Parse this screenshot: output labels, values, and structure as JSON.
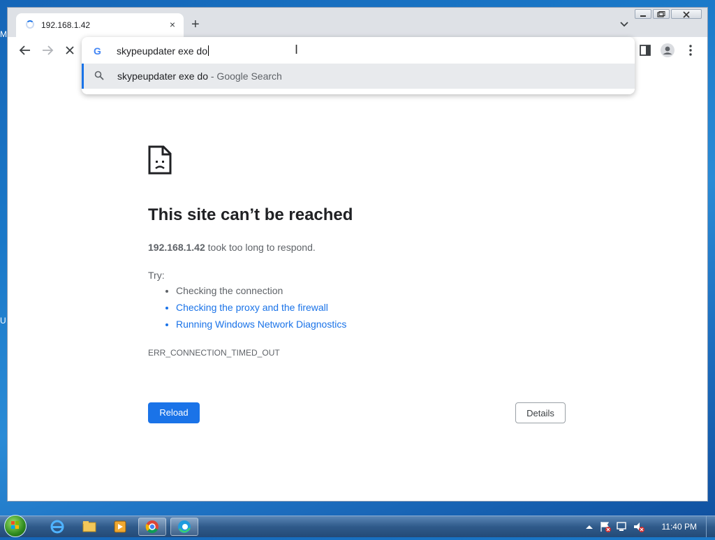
{
  "desktop": {
    "edge_fragment_1": "M",
    "edge_fragment_2": "U"
  },
  "browser": {
    "tab": {
      "title": "192.168.1.42",
      "close": "×"
    },
    "new_tab": "+",
    "omnibox": {
      "text": "skypeupdater exe do",
      "suggestion_query": "skypeupdater exe do",
      "suggestion_suffix": " - Google Search"
    }
  },
  "error_page": {
    "heading": "This site can’t be reached",
    "host": "192.168.1.42",
    "message": " took too long to respond.",
    "try_label": "Try:",
    "suggestions": [
      "Checking the connection",
      "Checking the proxy and the firewall",
      "Running Windows Network Diagnostics"
    ],
    "error_code": "ERR_CONNECTION_TIMED_OUT",
    "reload_label": "Reload",
    "details_label": "Details"
  },
  "taskbar": {
    "clock": "11:40 PM"
  },
  "colors": {
    "accent": "#1a73e8",
    "link": "#1a73e8",
    "text_secondary": "#5f6368"
  }
}
